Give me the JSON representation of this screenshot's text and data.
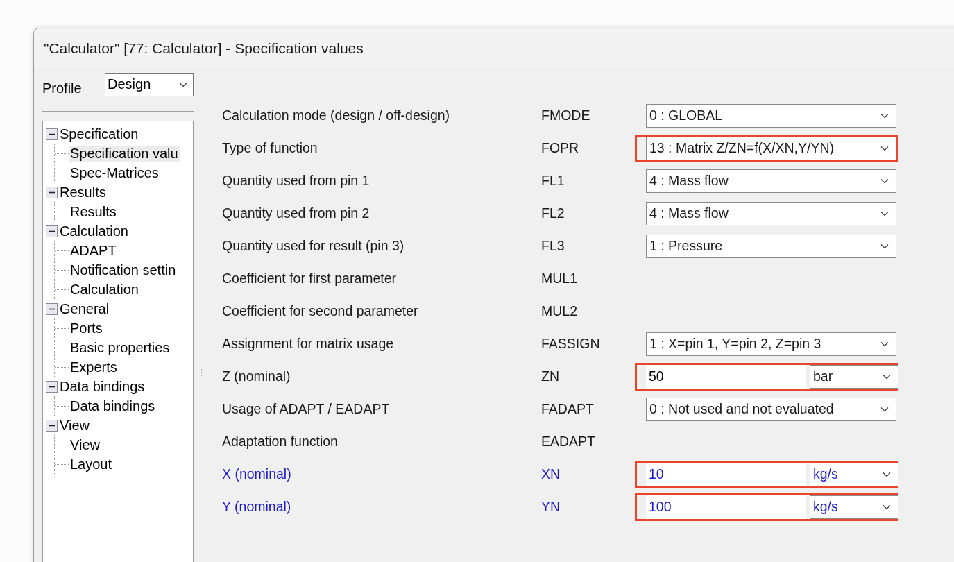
{
  "window": {
    "title": "\"Calculator\" [77: Calculator] - Specification values"
  },
  "profile": {
    "label": "Profile",
    "value": "Design"
  },
  "tree": [
    {
      "label": "Specification",
      "expanded": true,
      "children": [
        {
          "label": "Specification valu",
          "selected": true
        },
        {
          "label": "Spec-Matrices",
          "selected": false
        }
      ]
    },
    {
      "label": "Results",
      "expanded": true,
      "children": [
        {
          "label": "Results",
          "selected": false
        }
      ]
    },
    {
      "label": "Calculation",
      "expanded": true,
      "children": [
        {
          "label": "ADAPT",
          "selected": false
        },
        {
          "label": "Notification settin",
          "selected": false
        },
        {
          "label": "Calculation",
          "selected": false
        }
      ]
    },
    {
      "label": "General",
      "expanded": true,
      "children": [
        {
          "label": "Ports",
          "selected": false
        },
        {
          "label": "Basic properties",
          "selected": false
        },
        {
          "label": "Experts",
          "selected": false
        }
      ]
    },
    {
      "label": "Data bindings",
      "expanded": true,
      "children": [
        {
          "label": "Data bindings",
          "selected": false
        }
      ]
    },
    {
      "label": "View",
      "expanded": true,
      "children": [
        {
          "label": "View",
          "selected": false
        },
        {
          "label": "Layout",
          "selected": false
        }
      ]
    }
  ],
  "rows": [
    {
      "label": "Calculation mode (design / off-design)",
      "code": "FMODE",
      "kind": "select",
      "value": "0 : GLOBAL",
      "highlighted": false,
      "changed": false
    },
    {
      "label": "Type of function",
      "code": "FOPR",
      "kind": "select",
      "value": "13 : Matrix Z/ZN=f(X/XN,Y/YN)",
      "highlighted": true,
      "changed": false
    },
    {
      "label": "Quantity used from pin 1",
      "code": "FL1",
      "kind": "select",
      "value": "4 : Mass flow",
      "highlighted": false,
      "changed": false
    },
    {
      "label": "Quantity used from pin 2",
      "code": "FL2",
      "kind": "select",
      "value": "4 : Mass flow",
      "highlighted": false,
      "changed": false
    },
    {
      "label": "Quantity used for result (pin 3)",
      "code": "FL3",
      "kind": "select",
      "value": "1 : Pressure",
      "highlighted": false,
      "changed": false
    },
    {
      "label": "Coefficient for first parameter",
      "code": "MUL1",
      "kind": "none",
      "highlighted": false,
      "changed": false
    },
    {
      "label": "Coefficient for second parameter",
      "code": "MUL2",
      "kind": "none",
      "highlighted": false,
      "changed": false
    },
    {
      "label": "Assignment for matrix usage",
      "code": "FASSIGN",
      "kind": "select",
      "value": "1 : X=pin 1, Y=pin 2, Z=pin 3",
      "highlighted": false,
      "changed": false
    },
    {
      "label": "Z (nominal)",
      "code": "ZN",
      "kind": "value_unit",
      "value": "50",
      "unit": "bar",
      "highlighted": true,
      "changed": false
    },
    {
      "label": "Usage of ADAPT / EADAPT",
      "code": "FADAPT",
      "kind": "select",
      "value": "0 : Not used and not evaluated",
      "highlighted": false,
      "changed": false
    },
    {
      "label": "Adaptation function",
      "code": "EADAPT",
      "kind": "none",
      "highlighted": false,
      "changed": false
    },
    {
      "label": "X (nominal)",
      "code": "XN",
      "kind": "value_unit",
      "value": "10",
      "unit": "kg/s",
      "highlighted": true,
      "changed": true
    },
    {
      "label": "Y (nominal)",
      "code": "YN",
      "kind": "value_unit",
      "value": "100",
      "unit": "kg/s",
      "highlighted": true,
      "changed": true
    }
  ]
}
